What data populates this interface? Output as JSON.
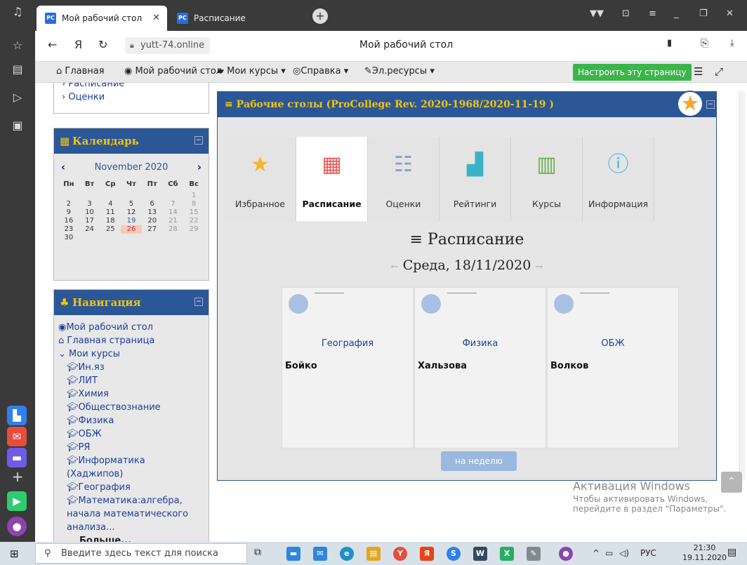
{
  "browser": {
    "tabs": [
      {
        "favicon": "PC",
        "label": "Мой рабочий стол",
        "active": true
      },
      {
        "favicon": "PC",
        "label": "Расписание",
        "active": false
      }
    ],
    "url": "yutt-74.online",
    "page_title": "Мой рабочий стол",
    "back_icon": "←",
    "yandex_icon": "Я",
    "reload_icon": "↻"
  },
  "topnav": {
    "home": "Главная",
    "dashboard": "Мой рабочий стол",
    "my_courses": "Мои курсы",
    "help": "Справка",
    "eresources": "Эл.ресурсы",
    "customize_button": "Настроить эту страницу"
  },
  "sidebar_top_links": [
    "Расписание",
    "Оценки"
  ],
  "calendar": {
    "title": "Календарь",
    "month": "November 2020",
    "weekdays": [
      "Пн",
      "Вт",
      "Ср",
      "Чт",
      "Пт",
      "Сб",
      "Вс"
    ],
    "weeks": [
      [
        "",
        "",
        "",
        "",
        "",
        "",
        "1"
      ],
      [
        "2",
        "3",
        "4",
        "5",
        "6",
        "7",
        "8"
      ],
      [
        "9",
        "10",
        "11",
        "12",
        "13",
        "14",
        "15"
      ],
      [
        "16",
        "17",
        "18",
        "19",
        "20",
        "21",
        "22"
      ],
      [
        "23",
        "24",
        "25",
        "26",
        "27",
        "28",
        "29"
      ],
      [
        "30",
        "",
        "",
        "",
        "",
        "",
        ""
      ]
    ],
    "today": "26",
    "highlighted": "19"
  },
  "navigation": {
    "title": "Навигация",
    "dashboard": "Мой рабочий стол",
    "home": "Главная страница",
    "my_courses": "Мои курсы",
    "courses": [
      "Ин.яз",
      "ЛИТ",
      "Химия",
      "Обществознание",
      "Физика",
      "ОБЖ",
      "РЯ",
      "Информатика (Хаджипов)",
      "География",
      "Математика:алгебра, начала математического анализа..."
    ],
    "more": "Больше..."
  },
  "panel": {
    "title": "Рабочие столы (ProCollege Rev. 2020-1968/2020-11-19 )",
    "tabs": [
      {
        "label": "Избранное",
        "icon": "star-icon"
      },
      {
        "label": "Расписание",
        "icon": "calendar-icon"
      },
      {
        "label": "Оценки",
        "icon": "checklist-icon"
      },
      {
        "label": "Рейтинги",
        "icon": "chart-icon"
      },
      {
        "label": "Курсы",
        "icon": "books-icon"
      },
      {
        "label": "Информация",
        "icon": "info-icon"
      }
    ],
    "active_tab": "Расписание",
    "schedule_title": "Расписание",
    "schedule_date": "Среда, 18/11/2020",
    "lessons": [
      {
        "subject": "География",
        "teacher": "Бойко"
      },
      {
        "subject": "Физика",
        "teacher": "Хальзова"
      },
      {
        "subject": "ОБЖ",
        "teacher": "Волков"
      }
    ],
    "week_button": "на неделю"
  },
  "activation": {
    "line1": "Активация Windows",
    "line2": "Чтобы активировать Windows,",
    "line3": "перейдите в раздел \"Параметры\"."
  },
  "taskbar": {
    "search_placeholder": "Введите здесь текст для поиска",
    "language": "РУС",
    "time": "21:30",
    "date": "19.11.2020"
  },
  "colors": {
    "brand_blue": "#2b5797",
    "accent_yellow": "#f1c40f",
    "green_button": "#3bb54a"
  }
}
